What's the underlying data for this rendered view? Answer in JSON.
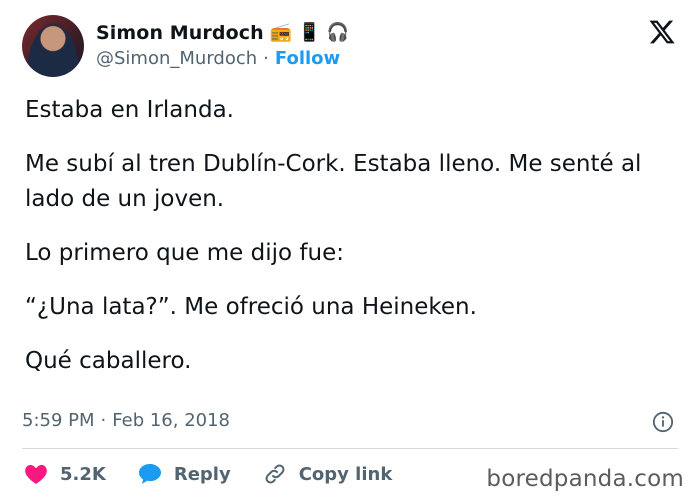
{
  "author": {
    "name": "Simon Murdoch",
    "handle": "@Simon_Murdoch",
    "separator": "·",
    "follow_label": "Follow",
    "badges": [
      "radio-icon",
      "mobile-phone-icon",
      "headphones-icon"
    ]
  },
  "tweet": {
    "paragraphs": [
      "Estaba en Irlanda.",
      "Me subí al tren Dublín-Cork. Estaba lleno. Me senté al lado de un joven.",
      "Lo primero que me dijo fue:",
      "“¿Una lata?”. Me ofreció una Heineken.",
      "Qué caballero."
    ],
    "time": "5:59 PM",
    "separator": "·",
    "date": "Feb 16, 2018"
  },
  "actions": {
    "likes": "5.2K",
    "reply_label": "Reply",
    "copy_link_label": "Copy link"
  },
  "watermark": "boredpanda.com",
  "colors": {
    "accent": "#1d9bf0",
    "like": "#f91880",
    "muted": "#536471",
    "text": "#0f1419"
  }
}
